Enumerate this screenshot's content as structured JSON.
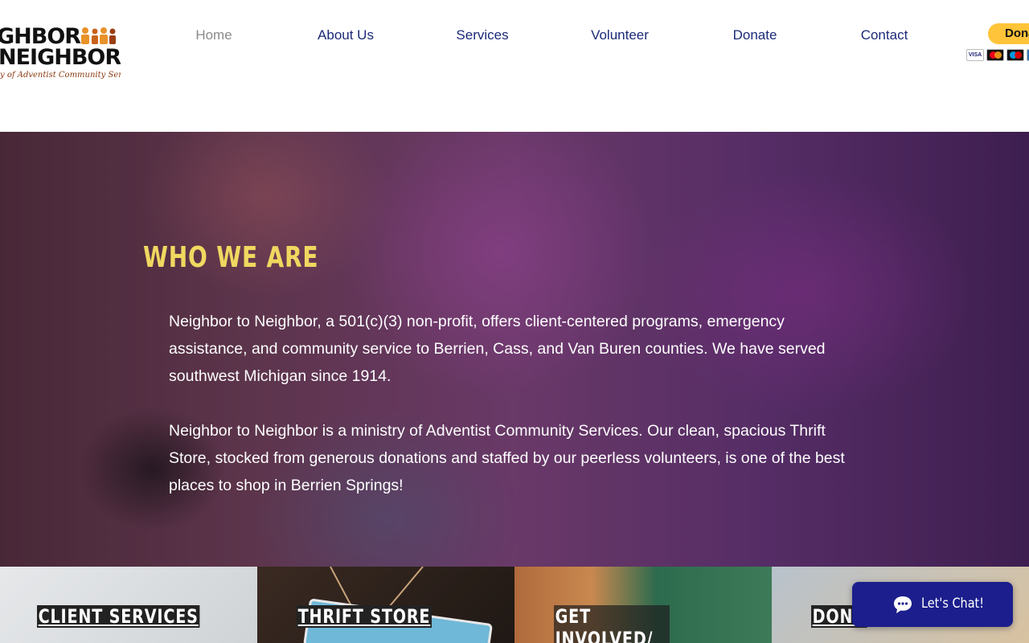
{
  "logo": {
    "line1": "GHBOR",
    "line2": "NEIGHBOR",
    "tagline": "y of Adventist Community Services"
  },
  "nav": {
    "items": [
      {
        "label": "Home",
        "active": true
      },
      {
        "label": "About Us",
        "active": false
      },
      {
        "label": "Services",
        "active": false
      },
      {
        "label": "Volunteer",
        "active": false
      },
      {
        "label": "Donate",
        "active": false
      },
      {
        "label": "Contact",
        "active": false
      }
    ]
  },
  "donate_widget": {
    "button_label": "Dona",
    "card_logos": [
      "visa",
      "mastercard",
      "maestro",
      "amex"
    ],
    "visa_text": "VISA",
    "button_color": "#ffc439"
  },
  "hero": {
    "title": "WHO WE ARE",
    "paragraph1": "Neighbor to Neighbor, a 501(c)(3) non-profit, offers client-centered programs, emergency assistance, and community service to Berrien, Cass, and Van Buren counties. We have served southwest Michigan since 1914.",
    "paragraph2": "Neighbor to Neighbor is a ministry of Adventist Community Services. Our clean, spacious Thrift Store, stocked from generous donations and staffed by our peerless volunteers, is one of the best places to shop in Berrien Springs!",
    "title_color": "#f0d860"
  },
  "tiles": [
    {
      "label": "CLIENT SERVICES"
    },
    {
      "label": "THRIFT STORE"
    },
    {
      "label": "GET INVOLVED/ VOLUNTEER"
    },
    {
      "label": "DONA"
    }
  ],
  "chat": {
    "label": "Let's Chat!",
    "icon": "chat-bubble-icon",
    "color": "#1b1e8c"
  },
  "colors": {
    "nav_link": "#1b2a78",
    "nav_active": "#8a8a8a"
  }
}
